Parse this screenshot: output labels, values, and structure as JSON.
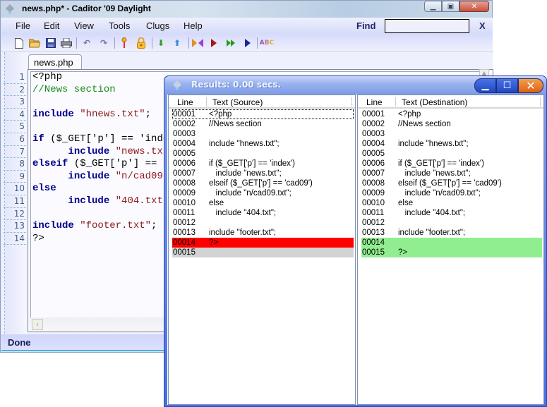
{
  "main_window": {
    "title": "news.php* - Caditor '09 Daylight",
    "menu": [
      "File",
      "Edit",
      "View",
      "Tools",
      "Clugs",
      "Help"
    ],
    "find": {
      "label": "Find",
      "value": "",
      "close_label": "X"
    },
    "toolbar": [
      {
        "name": "new-file-icon",
        "glyph": "🗋"
      },
      {
        "name": "open-folder-icon",
        "glyph": "📂"
      },
      {
        "name": "save-icon",
        "glyph": "💾"
      },
      {
        "name": "print-icon",
        "glyph": "🖶"
      },
      {
        "name": "undo-icon",
        "glyph": "↶"
      },
      {
        "name": "redo-icon",
        "glyph": "↷"
      },
      {
        "name": "key-icon",
        "glyph": "⚷"
      },
      {
        "name": "lock-icon",
        "glyph": "🔒"
      },
      {
        "name": "arrow-down-icon",
        "glyph": "⬇"
      },
      {
        "name": "arrow-up-icon",
        "glyph": "⬆"
      },
      {
        "name": "compare-icon",
        "glyph": "⧓"
      },
      {
        "name": "play-icon",
        "glyph": "▶"
      },
      {
        "name": "fast-forward-icon",
        "glyph": "⏩"
      },
      {
        "name": "step-icon",
        "glyph": "▶"
      },
      {
        "name": "spellcheck-icon",
        "glyph": "ABC"
      }
    ],
    "tab": "news.php",
    "code_lines": [
      {
        "n": "1",
        "tokens": [
          {
            "t": "<?php",
            "c": ""
          }
        ]
      },
      {
        "n": "2",
        "tokens": [
          {
            "t": "//News section",
            "c": "cm"
          }
        ]
      },
      {
        "n": "3",
        "tokens": []
      },
      {
        "n": "4",
        "tokens": [
          {
            "t": "include",
            "c": "kw"
          },
          {
            "t": " ",
            "c": ""
          },
          {
            "t": "\"hnews.txt\"",
            "c": "str"
          },
          {
            "t": ";",
            "c": ""
          }
        ]
      },
      {
        "n": "5",
        "tokens": []
      },
      {
        "n": "6",
        "tokens": [
          {
            "t": "if",
            "c": "kw"
          },
          {
            "t": " ($_GET['p'] == 'index')",
            "c": ""
          }
        ]
      },
      {
        "n": "7",
        "tokens": [
          {
            "t": "      ",
            "c": ""
          },
          {
            "t": "include",
            "c": "kw"
          },
          {
            "t": " ",
            "c": ""
          },
          {
            "t": "\"news.txt\"",
            "c": "str"
          },
          {
            "t": ";",
            "c": ""
          }
        ]
      },
      {
        "n": "8",
        "tokens": [
          {
            "t": "elseif",
            "c": "kw"
          },
          {
            "t": " ($_GET['p'] == 'cad09')",
            "c": ""
          }
        ]
      },
      {
        "n": "9",
        "tokens": [
          {
            "t": "      ",
            "c": ""
          },
          {
            "t": "include",
            "c": "kw"
          },
          {
            "t": " ",
            "c": ""
          },
          {
            "t": "\"n/cad09.txt\"",
            "c": "str"
          },
          {
            "t": ";",
            "c": ""
          }
        ]
      },
      {
        "n": "10",
        "tokens": [
          {
            "t": "else",
            "c": "kw"
          }
        ]
      },
      {
        "n": "11",
        "tokens": [
          {
            "t": "      ",
            "c": ""
          },
          {
            "t": "include",
            "c": "kw"
          },
          {
            "t": " ",
            "c": ""
          },
          {
            "t": "\"404.txt\"",
            "c": "str"
          },
          {
            "t": ";",
            "c": ""
          }
        ]
      },
      {
        "n": "12",
        "tokens": []
      },
      {
        "n": "13",
        "tokens": [
          {
            "t": "include",
            "c": "kw"
          },
          {
            "t": " ",
            "c": ""
          },
          {
            "t": "\"footer.txt\"",
            "c": "str"
          },
          {
            "t": ";",
            "c": ""
          }
        ]
      },
      {
        "n": "14",
        "tokens": [
          {
            "t": "?>",
            "c": ""
          }
        ]
      }
    ],
    "status": "Done"
  },
  "results_window": {
    "title": "Results: 0.00 secs.",
    "source": {
      "header_line": "Line",
      "header_text": "Text (Source)",
      "rows": [
        {
          "line": "00001",
          "text": "<?php",
          "state": "focus"
        },
        {
          "line": "00002",
          "text": "//News section",
          "state": ""
        },
        {
          "line": "00003",
          "text": "",
          "state": ""
        },
        {
          "line": "00004",
          "text": "include \"hnews.txt\";",
          "state": ""
        },
        {
          "line": "00005",
          "text": "",
          "state": ""
        },
        {
          "line": "00006",
          "text": "if ($_GET['p'] == 'index')",
          "state": ""
        },
        {
          "line": "00007",
          "text": "   include \"news.txt\";",
          "state": ""
        },
        {
          "line": "00008",
          "text": "elseif ($_GET['p'] == 'cad09')",
          "state": ""
        },
        {
          "line": "00009",
          "text": "   include \"n/cad09.txt\";",
          "state": ""
        },
        {
          "line": "00010",
          "text": "else",
          "state": ""
        },
        {
          "line": "00011",
          "text": "   include \"404.txt\";",
          "state": ""
        },
        {
          "line": "00012",
          "text": "",
          "state": ""
        },
        {
          "line": "00013",
          "text": "include \"footer.txt\";",
          "state": ""
        },
        {
          "line": "00014",
          "text": "?>",
          "state": "removed"
        },
        {
          "line": "00015",
          "text": "",
          "state": "empty"
        }
      ]
    },
    "destination": {
      "header_line": "Line",
      "header_text": "Text (Destination)",
      "rows": [
        {
          "line": "00001",
          "text": "<?php",
          "state": ""
        },
        {
          "line": "00002",
          "text": "//News section",
          "state": ""
        },
        {
          "line": "00003",
          "text": "",
          "state": ""
        },
        {
          "line": "00004",
          "text": "include \"hnews.txt\";",
          "state": ""
        },
        {
          "line": "00005",
          "text": "",
          "state": ""
        },
        {
          "line": "00006",
          "text": "if ($_GET['p'] == 'index')",
          "state": ""
        },
        {
          "line": "00007",
          "text": "   include \"news.txt\";",
          "state": ""
        },
        {
          "line": "00008",
          "text": "elseif ($_GET['p'] == 'cad09')",
          "state": ""
        },
        {
          "line": "00009",
          "text": "   include \"n/cad09.txt\";",
          "state": ""
        },
        {
          "line": "00010",
          "text": "else",
          "state": ""
        },
        {
          "line": "00011",
          "text": "   include \"404.txt\";",
          "state": ""
        },
        {
          "line": "00012",
          "text": "",
          "state": ""
        },
        {
          "line": "00013",
          "text": "include \"footer.txt\";",
          "state": ""
        },
        {
          "line": "00014",
          "text": "",
          "state": "added"
        },
        {
          "line": "00015",
          "text": "?>",
          "state": "added"
        }
      ]
    },
    "colors": {
      "removed": "#ff0000",
      "added": "#90ee90",
      "empty": "#d3d3d3"
    }
  }
}
